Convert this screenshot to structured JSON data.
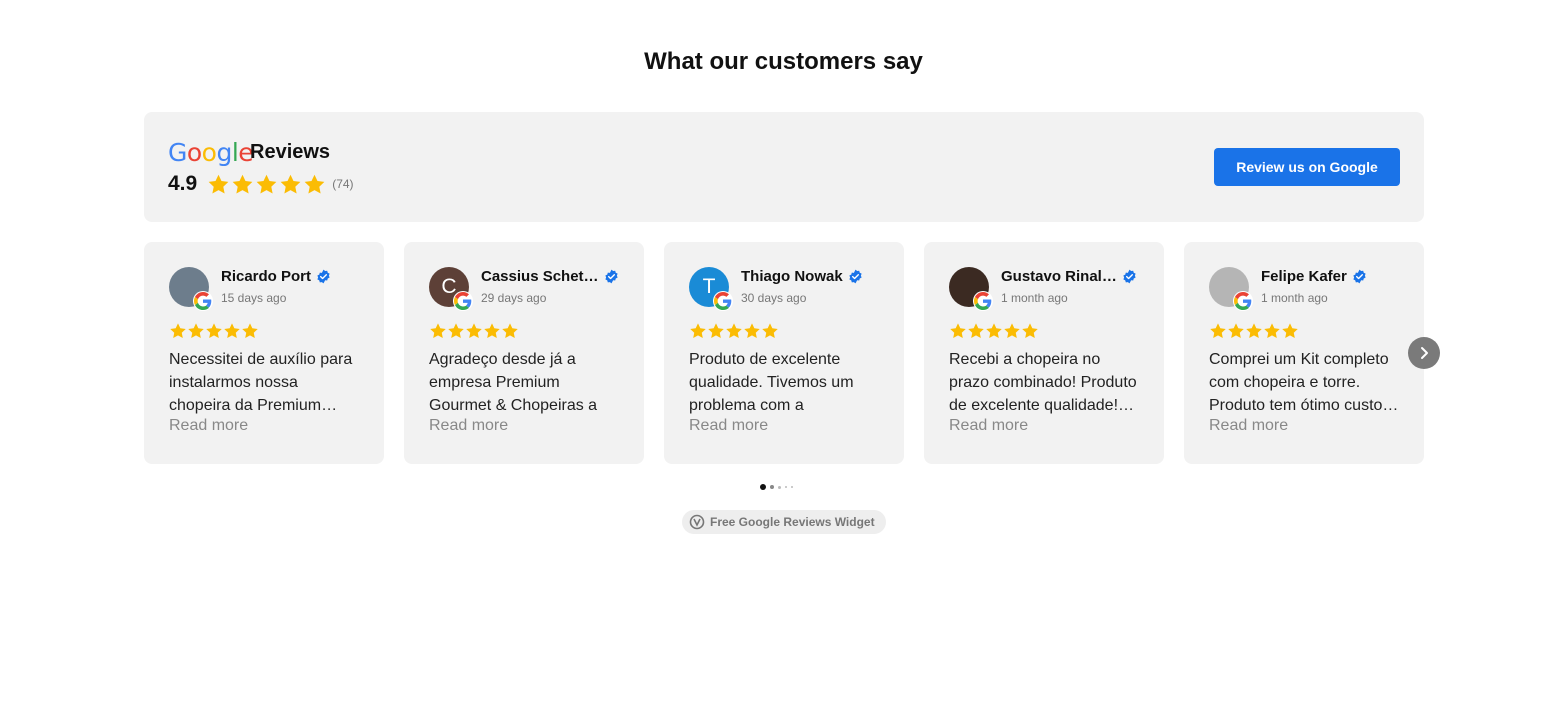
{
  "title": "What our customers say",
  "summary": {
    "logo_letters": [
      {
        "ch": "G",
        "color": "#4285F4"
      },
      {
        "ch": "o",
        "color": "#EA4335"
      },
      {
        "ch": "o",
        "color": "#FBBC05"
      },
      {
        "ch": "g",
        "color": "#4285F4"
      },
      {
        "ch": "l",
        "color": "#34A853"
      },
      {
        "ch": "e",
        "color": "#EA4335"
      }
    ],
    "reviews_label": "Reviews",
    "rating": "4.9",
    "count": "(74)",
    "button_label": "Review us on Google"
  },
  "reviews": [
    {
      "name": "Ricardo Port",
      "date": "15 days ago",
      "text": "Necessitei de auxílio para instalarmos nossa chopeira da Premium Gourmet",
      "read_more": "Read more",
      "avatar_color": "#6d7d8c",
      "avatar_letter": "",
      "stars": 5
    },
    {
      "name": "Cassius Schet…",
      "date": "29 days ago",
      "text": "Agradeço desde já a empresa Premium Gourmet & Chopeiras a",
      "read_more": "Read more",
      "avatar_color": "#5d4037",
      "avatar_letter": "C",
      "stars": 5
    },
    {
      "name": "Thiago Nowak",
      "date": "30 days ago",
      "text": "Produto de excelente qualidade. Tivemos um problema com a",
      "read_more": "Read more",
      "avatar_color": "#1a8bd6",
      "avatar_letter": "T",
      "stars": 5
    },
    {
      "name": "Gustavo Rinal…",
      "date": "1 month ago",
      "text": "Recebi a chopeira no prazo combinado! Produto de excelente qualidade! Recomendo",
      "read_more": "Read more",
      "avatar_color": "#3b2a22",
      "avatar_letter": "",
      "stars": 5
    },
    {
      "name": "Felipe Kafer",
      "date": "1 month ago",
      "text": "Comprei um Kit completo com chopeira e torre. Produto tem ótimo custo benefício",
      "read_more": "Read more",
      "avatar_color": "#b5b5b5",
      "avatar_letter": "",
      "stars": 5
    }
  ],
  "pagination": {
    "pages": 5,
    "current": 1
  },
  "widget_badge": "Free Google Reviews Widget",
  "colors": {
    "star": "#FBBC04",
    "button": "#1a73e8",
    "verified": "#1a73e8",
    "card_bg": "#f2f2f2"
  }
}
